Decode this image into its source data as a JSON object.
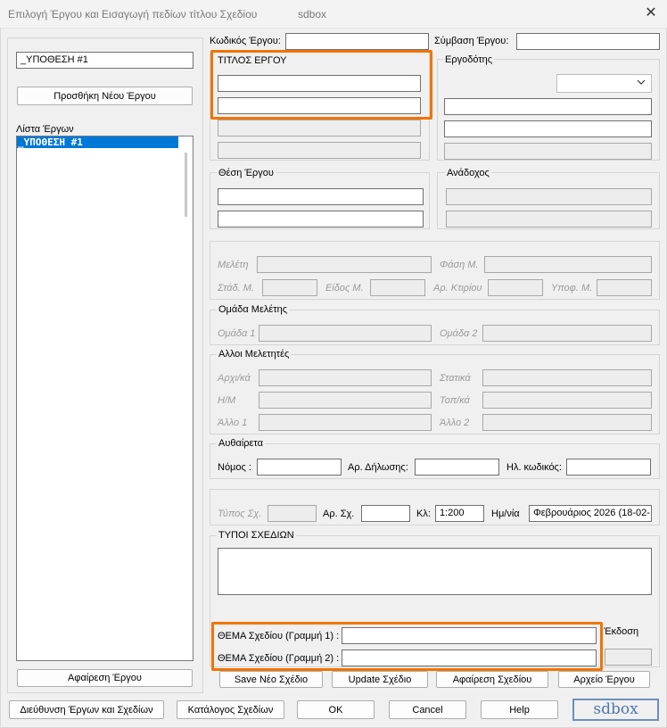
{
  "window": {
    "title": "Επιλογή Έργου και Εισαγωγή πεδίων τίτλου Σχεδίου",
    "app_name": "sdbox",
    "close_glyph": "✕"
  },
  "left": {
    "project_input": "_ΥΠΟΘΕΣΗ #1",
    "add_project_button": "Προσθήκη Νέου Έργου",
    "list_label": "Λίστα Έργων",
    "projects": [
      "_ΥΠΟΘΕΣΗ #1"
    ],
    "remove_project_button": "Αφαίρεση Έργου"
  },
  "top": {
    "project_code_label": "Κωδικός Έργου:",
    "project_code_value": "",
    "contract_label": "Σύμβαση Έργου:",
    "contract_value": ""
  },
  "project_title": {
    "label": "ΤΙΤΛΟΣ ΕΡΓΟΥ",
    "line1": "",
    "line2": ""
  },
  "employer": {
    "label": "Εργοδότης",
    "combo_value": ""
  },
  "location": {
    "label": "Θέση Έργου"
  },
  "contractor": {
    "label": "Ανάδοχος"
  },
  "study": {
    "study_label": "Μελέτη",
    "phase_label": "Φάση Μ.",
    "stage_label": "Στάδ. Μ.",
    "type_label": "Είδος Μ.",
    "building_label": "Αρ. Κτιρίου",
    "sub_label": "Υποφ. Μ."
  },
  "study_group": {
    "label": "Ομάδα Μελέτης",
    "group1_label": "Ομάδα 1",
    "group2_label": "Ομάδα 2"
  },
  "other_engineers": {
    "label": "Αλλοι Μελετητές",
    "arch_label": "Αρχι/κά",
    "static_label": "Στατικά",
    "mech_label": "Η/Μ",
    "topo_label": "Τοπ/κά",
    "other1_label": "Άλλο 1",
    "other2_label": "Άλλο 2"
  },
  "unauthorized": {
    "label": "Αυθαίρετα",
    "law_label": "Νόμος :",
    "decl_label": "Αρ. Δήλωσης:",
    "ecode_label": "Ηλ. κωδικός:"
  },
  "drawing": {
    "type_label": "Τύπος Σχ.",
    "num_label": "Αρ. Σχ.",
    "num_value": "",
    "scale_label": "Κλ:",
    "scale_value": "1:200",
    "date_label": "Ημ/νία",
    "date_value": "Φεβρουάριος 2026  (18-02-",
    "types_label": "ΤΥΠΟΙ ΣΧΕΔΙΩΝ",
    "subject1_label": "ΘΕΜΑ Σχεδίου (Γραμμή 1) :",
    "subject1_value": "",
    "subject2_label": "ΘΕΜΑ Σχεδίου (Γραμμή 2) :",
    "subject2_value": "",
    "edition_label": "Έκδοση"
  },
  "action_buttons": {
    "save_new": "Save Νέο Σχέδιο",
    "update": "Update Σχέδιο",
    "remove": "Αφαίρεση Σχεδίου",
    "archive": "Αρχείο Έργου"
  },
  "bottom_buttons": {
    "management": "Διεύθυνση Έργων και Σχεδίων",
    "catalog": "Κατάλογος Σχεδίων",
    "ok": "OK",
    "cancel": "Cancel",
    "help": "Help"
  },
  "logo": {
    "text": "sdbox"
  },
  "colors": {
    "highlight": "#f07400",
    "selection": "#0078d7"
  }
}
